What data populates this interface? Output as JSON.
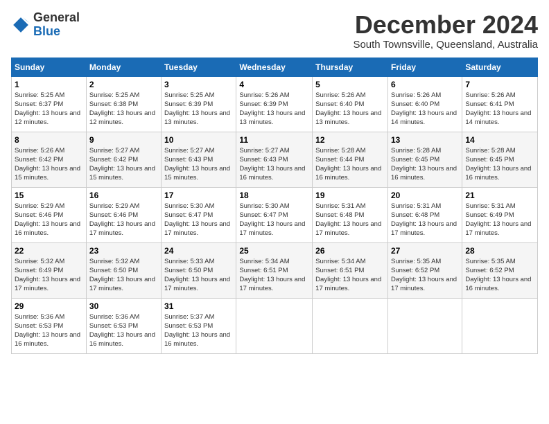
{
  "header": {
    "logo_general": "General",
    "logo_blue": "Blue",
    "month_title": "December 2024",
    "location": "South Townsville, Queensland, Australia"
  },
  "weekdays": [
    "Sunday",
    "Monday",
    "Tuesday",
    "Wednesday",
    "Thursday",
    "Friday",
    "Saturday"
  ],
  "weeks": [
    [
      {
        "day": "1",
        "sunrise": "5:25 AM",
        "sunset": "6:37 PM",
        "daylight": "13 hours and 12 minutes."
      },
      {
        "day": "2",
        "sunrise": "5:25 AM",
        "sunset": "6:38 PM",
        "daylight": "13 hours and 12 minutes."
      },
      {
        "day": "3",
        "sunrise": "5:25 AM",
        "sunset": "6:39 PM",
        "daylight": "13 hours and 13 minutes."
      },
      {
        "day": "4",
        "sunrise": "5:26 AM",
        "sunset": "6:39 PM",
        "daylight": "13 hours and 13 minutes."
      },
      {
        "day": "5",
        "sunrise": "5:26 AM",
        "sunset": "6:40 PM",
        "daylight": "13 hours and 13 minutes."
      },
      {
        "day": "6",
        "sunrise": "5:26 AM",
        "sunset": "6:40 PM",
        "daylight": "13 hours and 14 minutes."
      },
      {
        "day": "7",
        "sunrise": "5:26 AM",
        "sunset": "6:41 PM",
        "daylight": "13 hours and 14 minutes."
      }
    ],
    [
      {
        "day": "8",
        "sunrise": "5:26 AM",
        "sunset": "6:42 PM",
        "daylight": "13 hours and 15 minutes."
      },
      {
        "day": "9",
        "sunrise": "5:27 AM",
        "sunset": "6:42 PM",
        "daylight": "13 hours and 15 minutes."
      },
      {
        "day": "10",
        "sunrise": "5:27 AM",
        "sunset": "6:43 PM",
        "daylight": "13 hours and 15 minutes."
      },
      {
        "day": "11",
        "sunrise": "5:27 AM",
        "sunset": "6:43 PM",
        "daylight": "13 hours and 16 minutes."
      },
      {
        "day": "12",
        "sunrise": "5:28 AM",
        "sunset": "6:44 PM",
        "daylight": "13 hours and 16 minutes."
      },
      {
        "day": "13",
        "sunrise": "5:28 AM",
        "sunset": "6:45 PM",
        "daylight": "13 hours and 16 minutes."
      },
      {
        "day": "14",
        "sunrise": "5:28 AM",
        "sunset": "6:45 PM",
        "daylight": "13 hours and 16 minutes."
      }
    ],
    [
      {
        "day": "15",
        "sunrise": "5:29 AM",
        "sunset": "6:46 PM",
        "daylight": "13 hours and 16 minutes."
      },
      {
        "day": "16",
        "sunrise": "5:29 AM",
        "sunset": "6:46 PM",
        "daylight": "13 hours and 17 minutes."
      },
      {
        "day": "17",
        "sunrise": "5:30 AM",
        "sunset": "6:47 PM",
        "daylight": "13 hours and 17 minutes."
      },
      {
        "day": "18",
        "sunrise": "5:30 AM",
        "sunset": "6:47 PM",
        "daylight": "13 hours and 17 minutes."
      },
      {
        "day": "19",
        "sunrise": "5:31 AM",
        "sunset": "6:48 PM",
        "daylight": "13 hours and 17 minutes."
      },
      {
        "day": "20",
        "sunrise": "5:31 AM",
        "sunset": "6:48 PM",
        "daylight": "13 hours and 17 minutes."
      },
      {
        "day": "21",
        "sunrise": "5:31 AM",
        "sunset": "6:49 PM",
        "daylight": "13 hours and 17 minutes."
      }
    ],
    [
      {
        "day": "22",
        "sunrise": "5:32 AM",
        "sunset": "6:49 PM",
        "daylight": "13 hours and 17 minutes."
      },
      {
        "day": "23",
        "sunrise": "5:32 AM",
        "sunset": "6:50 PM",
        "daylight": "13 hours and 17 minutes."
      },
      {
        "day": "24",
        "sunrise": "5:33 AM",
        "sunset": "6:50 PM",
        "daylight": "13 hours and 17 minutes."
      },
      {
        "day": "25",
        "sunrise": "5:34 AM",
        "sunset": "6:51 PM",
        "daylight": "13 hours and 17 minutes."
      },
      {
        "day": "26",
        "sunrise": "5:34 AM",
        "sunset": "6:51 PM",
        "daylight": "13 hours and 17 minutes."
      },
      {
        "day": "27",
        "sunrise": "5:35 AM",
        "sunset": "6:52 PM",
        "daylight": "13 hours and 17 minutes."
      },
      {
        "day": "28",
        "sunrise": "5:35 AM",
        "sunset": "6:52 PM",
        "daylight": "13 hours and 16 minutes."
      }
    ],
    [
      {
        "day": "29",
        "sunrise": "5:36 AM",
        "sunset": "6:53 PM",
        "daylight": "13 hours and 16 minutes."
      },
      {
        "day": "30",
        "sunrise": "5:36 AM",
        "sunset": "6:53 PM",
        "daylight": "13 hours and 16 minutes."
      },
      {
        "day": "31",
        "sunrise": "5:37 AM",
        "sunset": "6:53 PM",
        "daylight": "13 hours and 16 minutes."
      },
      null,
      null,
      null,
      null
    ]
  ]
}
